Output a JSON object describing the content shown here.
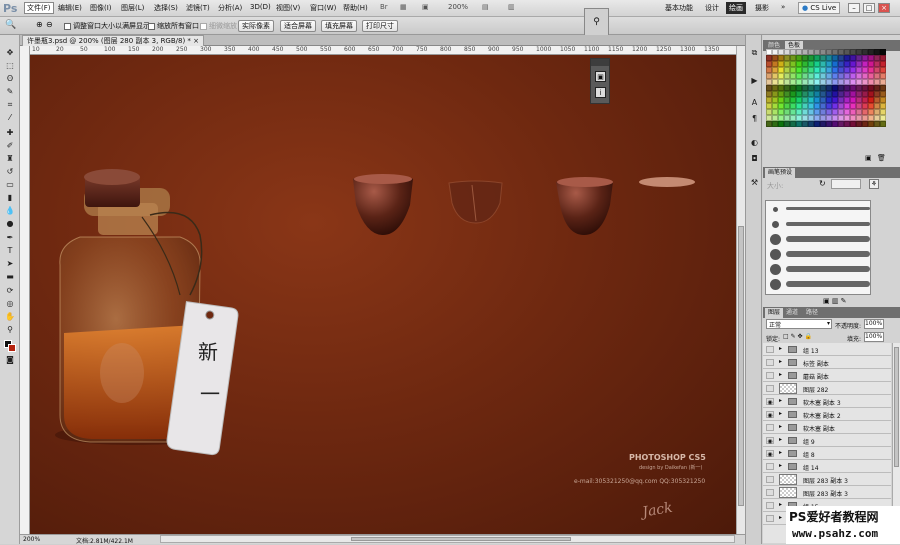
{
  "app": {
    "logo": "Ps"
  },
  "menubar": {
    "items": [
      "文件(F)",
      "编辑(E)",
      "图像(I)",
      "图层(L)",
      "选择(S)",
      "滤镜(T)",
      "分析(A)",
      "3D(D)",
      "视图(V)",
      "窗口(W)",
      "帮助(H)"
    ],
    "zoom": "200%",
    "workspaces": [
      "基本功能",
      "设计",
      "绘画",
      "摄影"
    ],
    "active_workspace": "绘画",
    "cs_live": "CS Live",
    "window_buttons": [
      "–",
      "□",
      "×"
    ]
  },
  "options": {
    "resize_label": "调整窗口大小以满屏显示",
    "zoom_all_label": "缩放所有窗口",
    "scrubby_label": "细微缩放",
    "buttons": [
      "实际像素",
      "适合屏幕",
      "填充屏幕",
      "打印尺寸"
    ]
  },
  "document": {
    "tab_title": "许墨瓶3.psd @ 200% (图层 280 副本 3, RGB/8) *",
    "tab_close": "×",
    "ruler_ticks": [
      "10",
      "20",
      "50",
      "100",
      "150",
      "200",
      "250",
      "300",
      "350",
      "400",
      "450",
      "500",
      "550",
      "600",
      "650",
      "700",
      "750",
      "800",
      "850",
      "900",
      "950",
      "1000",
      "1050",
      "1100",
      "1150",
      "1200",
      "1250",
      "1300",
      "1350"
    ],
    "label_char_1": "新",
    "label_char_2": "一",
    "credit_title": "PHOTOSHOP CS5",
    "credit_design": "design by Daikefan (新一)",
    "credit_contact": "e-mail:305321250@qq.com QQ:305321250",
    "signature": "Jack"
  },
  "status": {
    "zoom": "200%",
    "doc_size": "文档:2.81M/422.1M"
  },
  "panels": {
    "swatch_tabs": [
      "颜色",
      "色板"
    ],
    "brush_tabs": [
      "画笔预设"
    ],
    "brush_size_label": "大小:",
    "layer_tabs": [
      "图层",
      "通道",
      "路径"
    ],
    "blend_mode": "正常",
    "opacity_label": "不透明度:",
    "opacity_value": "100%",
    "lock_label": "锁定:",
    "fill_label": "填充:",
    "fill_value": "100%",
    "layers": [
      {
        "name": "组 13",
        "type": "group",
        "visible": false
      },
      {
        "name": "标签 副本",
        "type": "group",
        "visible": false
      },
      {
        "name": "蘑菇 副本",
        "type": "group",
        "visible": false
      },
      {
        "name": "图层 282",
        "type": "layer",
        "visible": false
      },
      {
        "name": "软木塞 副本 3",
        "type": "group",
        "visible": true
      },
      {
        "name": "软木塞 副本 2",
        "type": "group",
        "visible": true
      },
      {
        "name": "软木塞 副本",
        "type": "group",
        "visible": false
      },
      {
        "name": "组 9",
        "type": "group",
        "visible": true
      },
      {
        "name": "组 8",
        "type": "group",
        "visible": true
      },
      {
        "name": "组 14",
        "type": "group",
        "visible": false
      },
      {
        "name": "图层 283 副本 3",
        "type": "layer",
        "visible": false
      },
      {
        "name": "图层 283 副本 3",
        "type": "layer",
        "visible": false
      },
      {
        "name": "组 15",
        "type": "group",
        "visible": false
      },
      {
        "name": "组 16",
        "type": "group",
        "visible": false
      }
    ]
  },
  "watermark": {
    "line1": "PS爱好者教程网",
    "line2": "www.psahz.com"
  },
  "colors": {
    "canvas": "#6e2810",
    "accent": "#2a2a2a",
    "cork": "#5a2316"
  }
}
